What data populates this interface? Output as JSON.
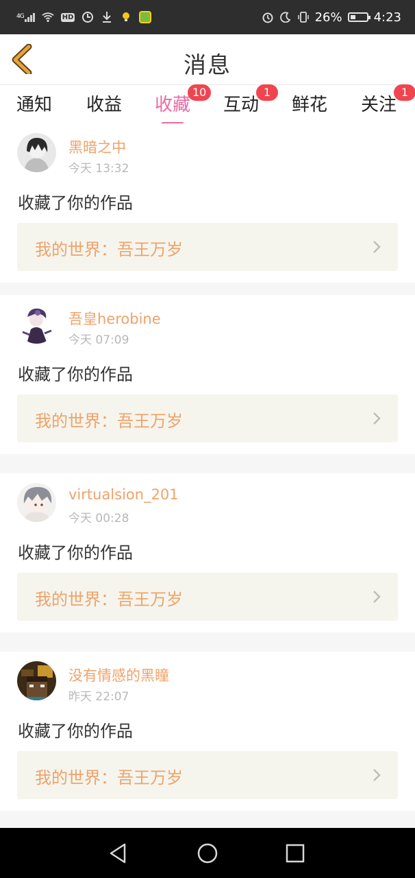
{
  "status_bar": {
    "network": "4G",
    "hd": "HD",
    "battery": "26%",
    "time": "4:23"
  },
  "header": {
    "title": "消息"
  },
  "tabs": [
    {
      "label": "通知",
      "badge": ""
    },
    {
      "label": "收益",
      "badge": ""
    },
    {
      "label": "收藏",
      "badge": "10",
      "active": true
    },
    {
      "label": "互动",
      "badge": "1"
    },
    {
      "label": "鲜花",
      "badge": ""
    },
    {
      "label": "关注",
      "badge": "1"
    }
  ],
  "messages": [
    {
      "user": "黑暗之中",
      "time": "今天 13:32",
      "action": "收藏了你的作品",
      "work": "我的世界：吾王万岁"
    },
    {
      "user": "吾皇herobine",
      "time": "今天 07:09",
      "action": "收藏了你的作品",
      "work": "我的世界：吾王万岁"
    },
    {
      "user": "virtualsion_201",
      "time": "今天 00:28",
      "action": "收藏了你的作品",
      "work": "我的世界：吾王万岁"
    },
    {
      "user": "没有情感的黑瞳",
      "time": "昨天 22:07",
      "action": "收藏了你的作品",
      "work": "我的世界：吾王万岁"
    }
  ],
  "colors": {
    "accent": "#e86aa3",
    "username": "#f0a268",
    "badge": "#f04550",
    "back_arrow": "#e7a33b"
  }
}
